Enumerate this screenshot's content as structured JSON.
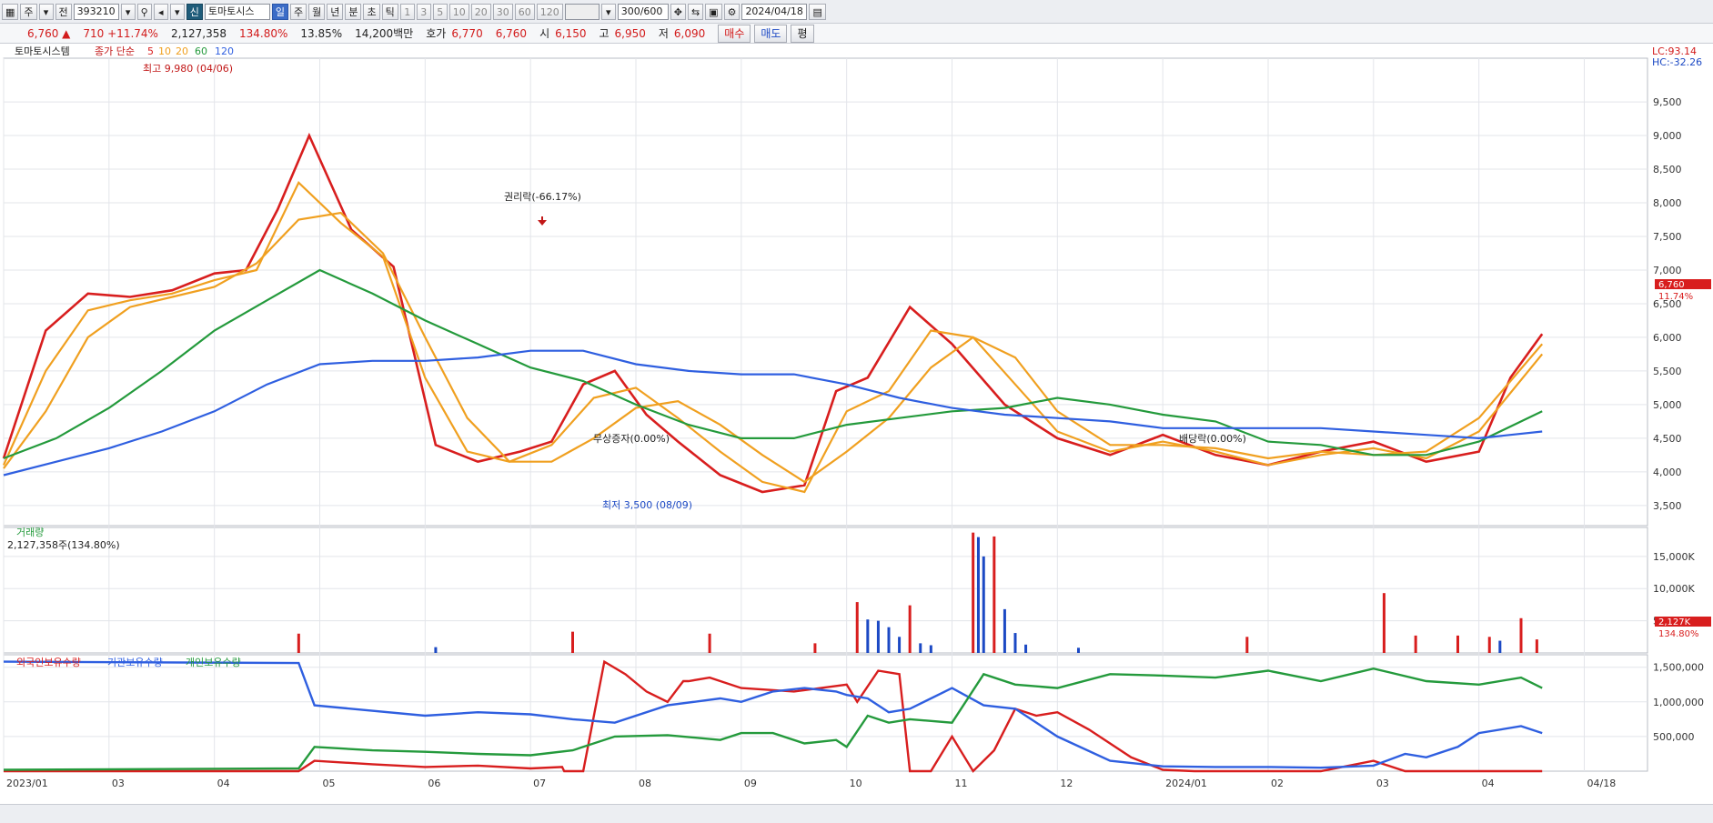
{
  "toolbar": {
    "stock_type": "주",
    "full_label": "전",
    "code": "393210",
    "credit_label": "신",
    "name": "토마토시스",
    "periods": [
      "일",
      "주",
      "월",
      "년",
      "분",
      "초",
      "틱"
    ],
    "active_period": "일",
    "intervals": [
      "1",
      "3",
      "5",
      "10",
      "20",
      "30",
      "60",
      "120"
    ],
    "count": "300",
    "count_max": "/600",
    "date": "2024/04/18"
  },
  "quote": {
    "price": "6,760 ▲",
    "change": "710 +11.74%",
    "volume": "2,127,358",
    "volume_ratio": "134.80%",
    "turnover": "13.85%",
    "amount": "14,200백만",
    "bid_label": "호가",
    "bid1": "6,770",
    "bid2": "6,760",
    "open_label": "시",
    "open": "6,150",
    "high_label": "고",
    "high": "6,950",
    "low_label": "저",
    "low": "6,090",
    "buy_label": "매수",
    "sell_label": "매도",
    "eval_label": "평"
  },
  "legend": {
    "price_title": "토마토시스템",
    "ma_label": "종가 단순",
    "ma_periods": [
      "5",
      "10",
      "20",
      "60",
      "120"
    ],
    "ma_colors": [
      "#d81e1e",
      "#f0a020",
      "#f0a020",
      "#249a3c",
      "#2f5fe0"
    ],
    "lc": "LC:93.14",
    "hc": "HC:-32.26",
    "volume_title": "거래량",
    "volume_value": "2,127,358주(134.80%)",
    "holding_labels": [
      "외국인보유수량",
      "기관보유수량",
      "개인보유수량"
    ],
    "holding_colors": [
      "#d81e1e",
      "#2f5fe0",
      "#249a3c"
    ]
  },
  "annotations": {
    "high": "최고 9,980 (04/06)",
    "low": "최저 3,500 (08/09)",
    "rights": "권리락(-66.17%)",
    "free_issue": "무상증자(0.00%)",
    "dividend": "배당락(0.00%)"
  },
  "current": {
    "price_tag": "6,760",
    "pct_tag": "11.74%",
    "vol_tag": "2,127K",
    "vol_pct_tag": "134.80%"
  },
  "chart_data": [
    {
      "type": "line",
      "title": "토마토시스템",
      "x_ticks": [
        "2023/01",
        "03",
        "04",
        "05",
        "06",
        "07",
        "08",
        "09",
        "10",
        "11",
        "12",
        "2024/01",
        "02",
        "03",
        "04",
        "04/18"
      ],
      "y_ticks": [
        3500,
        4000,
        4500,
        5000,
        5500,
        6000,
        6500,
        7000,
        7500,
        8000,
        8500,
        9000,
        9500
      ],
      "ylim": [
        3200,
        10150
      ],
      "series": [
        {
          "name": "5",
          "color": "#d81e1e",
          "x": [
            0,
            0.4,
            0.8,
            1.2,
            1.6,
            2.0,
            2.3,
            2.6,
            2.9,
            3.3,
            3.7,
            4.1,
            4.5,
            4.9,
            5.2,
            5.5,
            5.8,
            6.1,
            6.4,
            6.8,
            7.2,
            7.6,
            7.9,
            8.2,
            8.6,
            9.0,
            9.5,
            10.0,
            10.5,
            11.0,
            11.5,
            12.0,
            12.5,
            13.0,
            13.5,
            14.0,
            14.3,
            14.6
          ],
          "values": [
            4200,
            6100,
            6650,
            6600,
            6700,
            6950,
            7000,
            7900,
            9000,
            7600,
            7050,
            4400,
            4150,
            4300,
            4450,
            5300,
            5500,
            4850,
            4450,
            3950,
            3700,
            3800,
            5200,
            5400,
            6450,
            5900,
            5000,
            4500,
            4250,
            4550,
            4250,
            4100,
            4300,
            4450,
            4150,
            4300,
            5400,
            6050
          ]
        },
        {
          "name": "10",
          "color": "#f0a020",
          "x": [
            0,
            0.4,
            0.8,
            1.2,
            1.6,
            2.0,
            2.4,
            2.8,
            3.2,
            3.6,
            4.0,
            4.4,
            4.8,
            5.2,
            5.6,
            6.0,
            6.4,
            6.8,
            7.2,
            7.6,
            8.0,
            8.4,
            8.8,
            9.2,
            9.6,
            10.0,
            10.5,
            11.0,
            11.5,
            12.0,
            12.5,
            13.0,
            13.5,
            14.0,
            14.6
          ],
          "values": [
            4100,
            5500,
            6400,
            6550,
            6650,
            6850,
            7000,
            8300,
            7700,
            7200,
            5400,
            4300,
            4150,
            4400,
            5100,
            5250,
            4800,
            4300,
            3850,
            3700,
            4900,
            5200,
            6100,
            6000,
            5300,
            4600,
            4300,
            4450,
            4300,
            4100,
            4250,
            4350,
            4200,
            4600,
            5750
          ]
        },
        {
          "name": "20",
          "color": "#f0a020",
          "x": [
            0,
            0.4,
            0.8,
            1.2,
            1.6,
            2.0,
            2.4,
            2.8,
            3.2,
            3.6,
            4.0,
            4.4,
            4.8,
            5.2,
            5.6,
            6.0,
            6.4,
            6.8,
            7.2,
            7.6,
            8.0,
            8.4,
            8.8,
            9.2,
            9.6,
            10.0,
            10.5,
            11.0,
            11.5,
            12.0,
            12.5,
            13.0,
            13.5,
            14.0,
            14.6
          ],
          "values": [
            4050,
            4900,
            6000,
            6450,
            6600,
            6750,
            7100,
            7750,
            7850,
            7250,
            6000,
            4800,
            4150,
            4150,
            4500,
            4950,
            5050,
            4700,
            4250,
            3850,
            4300,
            4800,
            5550,
            6000,
            5700,
            4900,
            4400,
            4400,
            4350,
            4200,
            4300,
            4250,
            4300,
            4800,
            5900
          ]
        },
        {
          "name": "60",
          "color": "#249a3c",
          "x": [
            0,
            0.5,
            1.0,
            1.5,
            2.0,
            2.5,
            3.0,
            3.5,
            4.0,
            4.5,
            5.0,
            5.5,
            6.0,
            6.5,
            7.0,
            7.5,
            8.0,
            8.5,
            9.0,
            9.5,
            10.0,
            10.5,
            11.0,
            11.5,
            12.0,
            12.5,
            13.0,
            13.5,
            14.0,
            14.6
          ],
          "values": [
            4200,
            4500,
            4950,
            5500,
            6100,
            6550,
            7000,
            6650,
            6250,
            5900,
            5550,
            5350,
            5000,
            4700,
            4500,
            4500,
            4700,
            4800,
            4900,
            4950,
            5100,
            5000,
            4850,
            4750,
            4450,
            4400,
            4250,
            4250,
            4450,
            4900
          ]
        },
        {
          "name": "120",
          "color": "#2f5fe0",
          "x": [
            0,
            0.5,
            1.0,
            1.5,
            2.0,
            2.5,
            3.0,
            3.5,
            4.0,
            4.5,
            5.0,
            5.5,
            6.0,
            6.5,
            7.0,
            7.5,
            8.0,
            8.5,
            9.0,
            9.5,
            10.0,
            10.5,
            11.0,
            11.5,
            12.0,
            12.5,
            13.0,
            13.5,
            14.0,
            14.6
          ],
          "values": [
            3950,
            4150,
            4350,
            4600,
            4900,
            5300,
            5600,
            5650,
            5650,
            5700,
            5800,
            5800,
            5600,
            5500,
            5450,
            5450,
            5300,
            5100,
            4950,
            4850,
            4800,
            4750,
            4650,
            4650,
            4650,
            4650,
            4600,
            4550,
            4500,
            4600
          ]
        }
      ]
    },
    {
      "type": "bar",
      "title": "거래량",
      "yticks": [
        5000,
        10000,
        15000
      ],
      "ytick_labels": [
        "5,000K",
        "10,000K",
        "15,000K"
      ],
      "ylim": [
        0,
        19500
      ],
      "x": [
        2.8,
        4.1,
        5.4,
        6.7,
        7.7,
        8.1,
        8.2,
        8.3,
        8.4,
        8.5,
        8.6,
        8.7,
        8.8,
        9.2,
        9.25,
        9.3,
        9.4,
        9.5,
        9.6,
        9.7,
        10.2,
        11.8,
        13.1,
        13.4,
        13.8,
        14.1,
        14.2,
        14.4,
        14.55
      ],
      "values": [
        3000,
        900,
        3300,
        3000,
        1500,
        7900,
        5200,
        5000,
        4000,
        2500,
        7400,
        1500,
        1200,
        18700,
        18000,
        15000,
        18100,
        6800,
        3100,
        1300,
        800,
        2500,
        9300,
        2700,
        2700,
        2500,
        1900,
        5400,
        2100
      ],
      "colors": [
        "#d81e1e",
        "#1c49c4",
        "#d81e1e",
        "#d81e1e",
        "#d81e1e",
        "#d81e1e",
        "#1c49c4",
        "#1c49c4",
        "#1c49c4",
        "#1c49c4",
        "#d81e1e",
        "#1c49c4",
        "#1c49c4",
        "#d81e1e",
        "#1c49c4",
        "#1c49c4",
        "#d81e1e",
        "#1c49c4",
        "#1c49c4",
        "#1c49c4",
        "#1c49c4",
        "#d81e1e",
        "#d81e1e",
        "#d81e1e",
        "#d81e1e",
        "#d81e1e",
        "#1c49c4",
        "#d81e1e",
        "#d81e1e"
      ]
    },
    {
      "type": "line",
      "title": "보유수량",
      "yticks": [
        500000,
        1000000,
        1500000
      ],
      "ytick_labels": [
        "500,000",
        "1,000,000",
        "1,500,000"
      ],
      "ylim": [
        0,
        1680000
      ],
      "series": [
        {
          "name": "외국인보유수량",
          "color": "#d81e1e",
          "x": [
            0,
            2.8,
            2.95,
            3.5,
            4.0,
            4.5,
            5.0,
            5.3,
            5.32,
            5.5,
            5.7,
            5.9,
            6.1,
            6.3,
            6.45,
            6.5,
            6.7,
            7.0,
            7.5,
            8.0,
            8.1,
            8.3,
            8.5,
            8.6,
            8.8,
            9.0,
            9.2,
            9.4,
            9.6,
            9.8,
            10.0,
            10.3,
            10.7,
            11.0,
            11.3,
            11.6,
            12.0,
            12.5,
            13.0,
            13.3,
            13.7,
            14.0,
            14.6
          ],
          "values": [
            0,
            0,
            150000,
            100000,
            60000,
            80000,
            40000,
            60000,
            0,
            0,
            1580000,
            1400000,
            1150000,
            1000000,
            1300000,
            1300000,
            1350000,
            1200000,
            1150000,
            1250000,
            1000000,
            1450000,
            1400000,
            0,
            0,
            500000,
            0,
            300000,
            900000,
            800000,
            850000,
            600000,
            200000,
            20000,
            0,
            0,
            0,
            0,
            150000,
            0,
            0,
            0,
            0
          ]
        },
        {
          "name": "기관보유수량",
          "color": "#2f5fe0",
          "x": [
            0,
            2.8,
            2.95,
            4.0,
            4.5,
            5.0,
            5.4,
            5.8,
            6.3,
            6.8,
            7.0,
            7.3,
            7.6,
            7.9,
            8.0,
            8.2,
            8.4,
            8.6,
            9.0,
            9.3,
            9.6,
            10.0,
            10.5,
            11.0,
            11.5,
            12.0,
            12.5,
            13.0,
            13.3,
            13.5,
            13.8,
            14.0,
            14.4,
            14.6
          ],
          "values": [
            1580000,
            1560000,
            950000,
            800000,
            850000,
            820000,
            750000,
            700000,
            950000,
            1050000,
            1000000,
            1150000,
            1200000,
            1150000,
            1100000,
            1050000,
            850000,
            900000,
            1200000,
            950000,
            900000,
            500000,
            150000,
            70000,
            60000,
            60000,
            50000,
            80000,
            250000,
            200000,
            350000,
            550000,
            650000,
            550000
          ]
        },
        {
          "name": "개인보유수량",
          "color": "#249a3c",
          "x": [
            0,
            2.8,
            2.95,
            3.5,
            4.0,
            4.5,
            5.0,
            5.4,
            5.8,
            6.3,
            6.8,
            7.0,
            7.3,
            7.6,
            7.9,
            8.0,
            8.2,
            8.4,
            8.6,
            9.0,
            9.3,
            9.6,
            10.0,
            10.5,
            11.0,
            11.5,
            12.0,
            12.5,
            13.0,
            13.5,
            14.0,
            14.4,
            14.6
          ],
          "values": [
            20000,
            40000,
            350000,
            300000,
            280000,
            250000,
            230000,
            300000,
            500000,
            520000,
            450000,
            550000,
            550000,
            400000,
            450000,
            350000,
            800000,
            700000,
            750000,
            700000,
            1400000,
            1250000,
            1200000,
            1400000,
            1380000,
            1350000,
            1450000,
            1300000,
            1480000,
            1300000,
            1250000,
            1350000,
            1200000
          ]
        }
      ]
    }
  ]
}
